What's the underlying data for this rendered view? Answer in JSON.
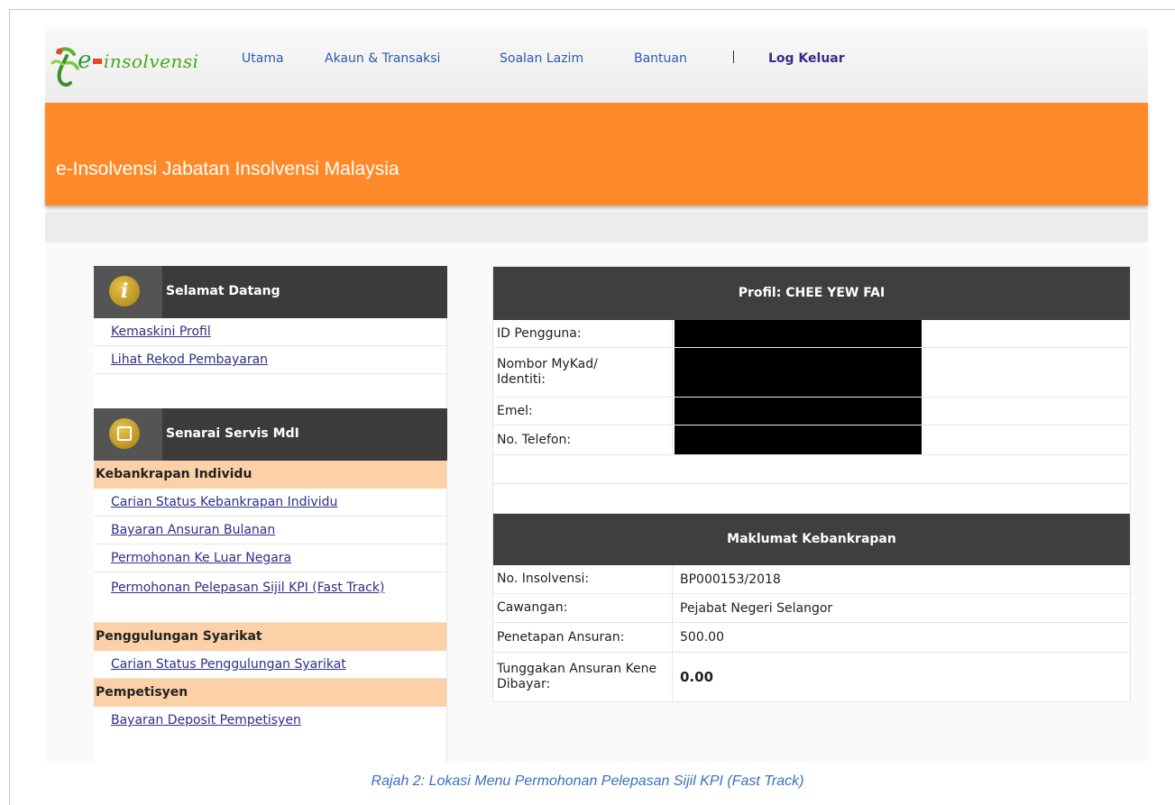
{
  "logo": {
    "prefix": "e",
    "text": "insolvensi"
  },
  "nav": {
    "items": [
      "Utama",
      "Akaun & Transaksi",
      "Soalan Lazim",
      "Bantuan"
    ],
    "logout": "Log Keluar"
  },
  "banner": {
    "title": "e-Insolvensi Jabatan Insolvensi Malaysia"
  },
  "sidebar": {
    "welcome": {
      "icon": "info-icon",
      "title": "Selamat Datang",
      "links": [
        "Kemaskini Profil",
        "Lihat Rekod Pembayaran"
      ]
    },
    "services": {
      "icon": "square-icon",
      "title": "Senarai Servis MdI",
      "categories": [
        {
          "name": "Kebankrapan Individu",
          "links": [
            "Carian Status Kebankrapan Individu",
            "Bayaran Ansuran Bulanan",
            "Permohonan Ke Luar Negara",
            "Permohonan Pelepasan Sijil KPI (Fast Track)"
          ]
        },
        {
          "name": "Penggulungan Syarikat",
          "links": [
            "Carian Status Penggulungan Syarikat"
          ]
        },
        {
          "name": "Pempetisyen",
          "links": [
            "Bayaran Deposit Pempetisyen"
          ]
        }
      ]
    }
  },
  "profile": {
    "title": "Profil: CHEE YEW FAI",
    "rows": [
      {
        "label": "ID Pengguna:",
        "value": ""
      },
      {
        "label": "Nombor MyKad/ Identiti:",
        "value": ""
      },
      {
        "label": "Emel:",
        "value": ""
      },
      {
        "label": "No. Telefon:",
        "value": ""
      }
    ]
  },
  "bankruptcy": {
    "title": "Maklumat Kebankrapan",
    "rows": [
      {
        "label": "No. Insolvensi:",
        "value": "BP000153/2018"
      },
      {
        "label": "Cawangan:",
        "value": "Pejabat Negeri Selangor"
      },
      {
        "label": "Penetapan Ansuran:",
        "value": "500.00"
      },
      {
        "label": "Tunggakan Ansuran Kene Dibayar:",
        "value": "0.00"
      }
    ]
  },
  "caption": "Rajah 2: Lokasi Menu Permohonan Pelepasan Sijil KPI (Fast Track)",
  "colors": {
    "banner": "#ff8a2a",
    "header": "#3f3f3f",
    "category": "#fcd1a8",
    "link": "#2e2e8a"
  }
}
